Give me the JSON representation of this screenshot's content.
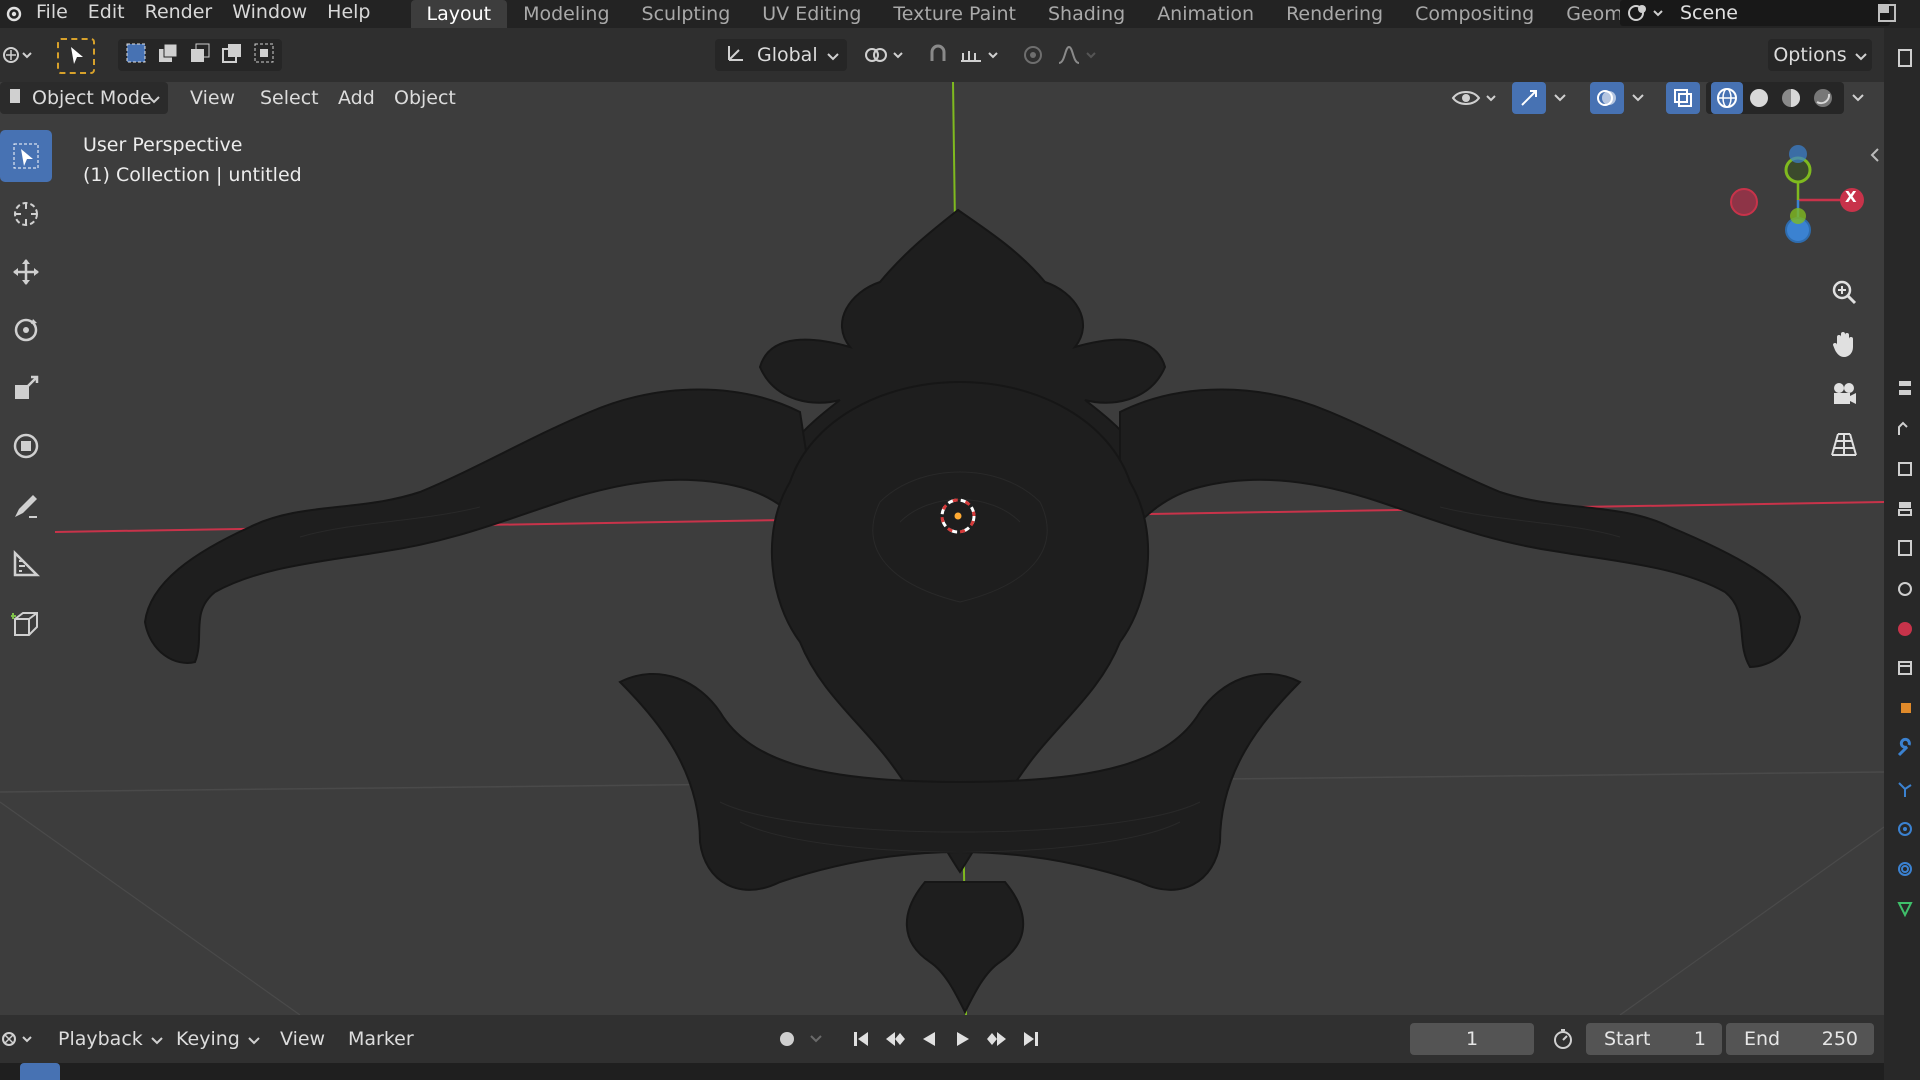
{
  "menu": {
    "file": "File",
    "edit": "Edit",
    "render": "Render",
    "window": "Window",
    "help": "Help"
  },
  "workspaces": [
    "Layout",
    "Modeling",
    "Sculpting",
    "UV Editing",
    "Texture Paint",
    "Shading",
    "Animation",
    "Rendering",
    "Compositing",
    "Geometry Nod"
  ],
  "scene": {
    "label": "Scene"
  },
  "tool_header": {
    "orientation": "Global",
    "options": "Options"
  },
  "view_header": {
    "mode": "Object Mode",
    "view": "View",
    "select": "Select",
    "add": "Add",
    "object": "Object"
  },
  "viewport": {
    "perspective": "User Perspective",
    "collection": "(1) Collection | untitled",
    "gizmo_x": "X"
  },
  "timeline": {
    "playback": "Playback",
    "keying": "Keying",
    "view": "View",
    "marker": "Marker",
    "current_frame": "1",
    "start_label": "Start",
    "start_value": "1",
    "end_label": "End",
    "end_value": "250"
  },
  "colors": {
    "accent": "#4772b3",
    "x_axis": "#c8334a",
    "y_axis": "#7fba1f",
    "z_axis": "#3b82d1",
    "viewport_bg": "#3d3d3d"
  }
}
